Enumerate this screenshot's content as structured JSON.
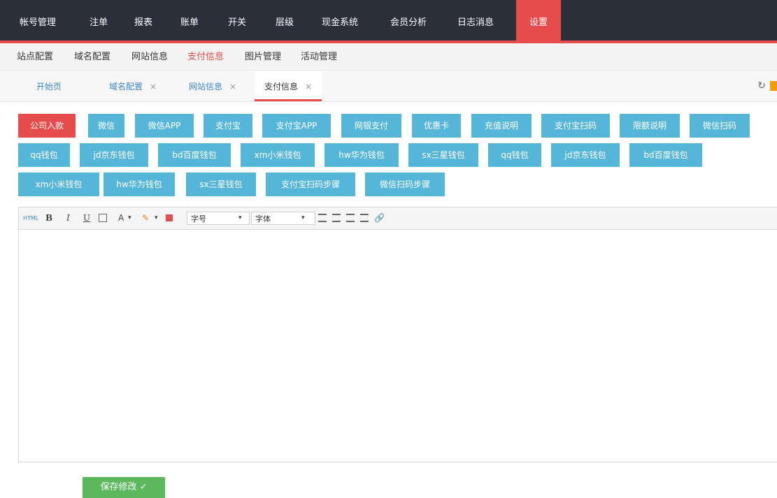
{
  "topnav": {
    "items": [
      {
        "label": "帐号管理"
      },
      {
        "label": "注单"
      },
      {
        "label": "报表"
      },
      {
        "label": "账单"
      },
      {
        "label": "开关"
      },
      {
        "label": "层级"
      },
      {
        "label": "现金系统"
      },
      {
        "label": "会员分析"
      },
      {
        "label": "日志消息"
      },
      {
        "label": "设置",
        "active": true
      }
    ]
  },
  "subnav": {
    "items": [
      {
        "label": "站点配置"
      },
      {
        "label": "域名配置"
      },
      {
        "label": "网站信息"
      },
      {
        "label": "支付信息",
        "active": true
      },
      {
        "label": "图片管理"
      },
      {
        "label": "活动管理"
      }
    ]
  },
  "tabs": {
    "items": [
      {
        "label": "开始页"
      },
      {
        "label": "域名配置",
        "close": "×"
      },
      {
        "label": "网站信息",
        "close": "×"
      },
      {
        "label": "支付信息",
        "close": "×",
        "active": true
      }
    ],
    "tools": {
      "refresh": "↻"
    }
  },
  "pay_buttons": [
    "公司入款",
    "微信",
    "微信APP",
    "支付宝",
    "支付宝APP",
    "网银支付",
    "优惠卡",
    "充值说明",
    "支付宝扫码",
    "限额说明",
    "微信扫码",
    "qq钱包",
    "jd京东钱包",
    "bd百度钱包",
    "xm小米钱包",
    "hw华为钱包",
    "sx三星钱包",
    "qq钱包",
    "jd京东钱包",
    "bd百度钱包",
    "xm小米钱包",
    "hw华为钱包",
    "sx三星钱包",
    "支付宝扫码步骤",
    "微信扫码步骤"
  ],
  "editor": {
    "toolbar": {
      "html": "HTML",
      "bold": "B",
      "italic": "I",
      "underline": "U",
      "fontcolor": "A",
      "dropdown": "▾",
      "highlight": "✎",
      "font_size": "字号",
      "font_family": "字体",
      "link": "🔗"
    },
    "content": ""
  },
  "save": {
    "label": "保存修改 ✓"
  },
  "colors": {
    "accent": "#e74c4c",
    "button": "#55b6d9",
    "save": "#5cb85c",
    "nav_bg": "#2b2f3a"
  }
}
